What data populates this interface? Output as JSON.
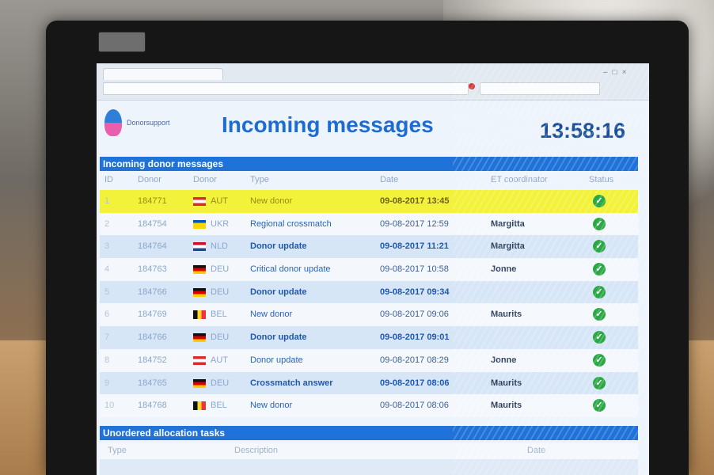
{
  "app": {
    "name": "Donorsupport"
  },
  "header": {
    "title": "Incoming messages",
    "clock": "13:58:16"
  },
  "sections": {
    "incoming_title": "Incoming donor messages",
    "lower_title": "Unordered allocation tasks"
  },
  "columns": [
    "ID",
    "Donor",
    "Donor",
    "Type",
    "Date",
    "ET coordinator",
    "Status"
  ],
  "lower_columns": [
    "Type",
    "Description",
    "Date"
  ],
  "colors": {
    "accent": "#1f73d8",
    "highlight": "#f2f23a",
    "status_ok": "#2aa844"
  },
  "rows": [
    {
      "nr": "1",
      "donor": "184771",
      "flag": "AUT",
      "country": "AUT",
      "type": "New donor",
      "date": "09-08-2017 13:45",
      "coordinator": "",
      "status": "check-icon",
      "style": "highlight"
    },
    {
      "nr": "2",
      "donor": "184754",
      "flag": "UKR",
      "country": "UKR",
      "type": "Regional crossmatch",
      "date": "09-08-2017 12:59",
      "coordinator": "Margitta",
      "status": "check-icon",
      "style": "odd"
    },
    {
      "nr": "3",
      "donor": "184764",
      "flag": "NLD",
      "country": "NLD",
      "type": "Donor update",
      "date": "09-08-2017 11:21",
      "coordinator": "Margitta",
      "status": "check-icon",
      "style": "even bold"
    },
    {
      "nr": "4",
      "donor": "184763",
      "flag": "DEU",
      "country": "DEU",
      "type": "Critical donor update",
      "date": "09-08-2017 10:58",
      "coordinator": "Jonne",
      "status": "check-icon",
      "style": "odd"
    },
    {
      "nr": "5",
      "donor": "184766",
      "flag": "DEU",
      "country": "DEU",
      "type": "Donor update",
      "date": "09-08-2017 09:34",
      "coordinator": "",
      "status": "check-icon",
      "style": "even bold"
    },
    {
      "nr": "6",
      "donor": "184769",
      "flag": "BEL",
      "country": "BEL",
      "type": "New donor",
      "date": "09-08-2017 09:06",
      "coordinator": "Maurits",
      "status": "check-icon",
      "style": "odd"
    },
    {
      "nr": "7",
      "donor": "184766",
      "flag": "DEU",
      "country": "DEU",
      "type": "Donor update",
      "date": "09-08-2017 09:01",
      "coordinator": "",
      "status": "check-icon",
      "style": "even bold"
    },
    {
      "nr": "8",
      "donor": "184752",
      "flag": "AUT",
      "country": "AUT",
      "type": "Donor update",
      "date": "09-08-2017 08:29",
      "coordinator": "Jonne",
      "status": "check-icon",
      "style": "odd"
    },
    {
      "nr": "9",
      "donor": "184765",
      "flag": "DEU",
      "country": "DEU",
      "type": "Crossmatch answer",
      "date": "09-08-2017 08:06",
      "coordinator": "Maurits",
      "status": "check-icon",
      "style": "even bold"
    },
    {
      "nr": "10",
      "donor": "184768",
      "flag": "BEL",
      "country": "BEL",
      "type": "New donor",
      "date": "09-08-2017 08:06",
      "coordinator": "Maurits",
      "status": "check-icon",
      "style": "odd"
    }
  ]
}
